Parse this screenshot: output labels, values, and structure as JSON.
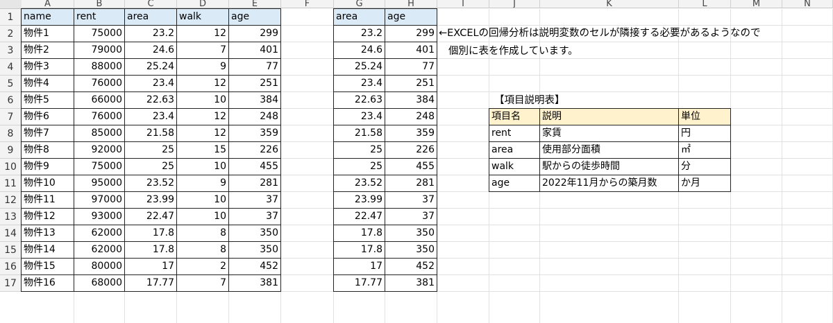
{
  "columns": [
    "A",
    "B",
    "C",
    "D",
    "E",
    "F",
    "G",
    "H",
    "I",
    "J",
    "K",
    "L",
    "M",
    "N"
  ],
  "rows": [
    "1",
    "2",
    "3",
    "4",
    "5",
    "6",
    "7",
    "8",
    "9",
    "10",
    "11",
    "12",
    "13",
    "14",
    "15",
    "16",
    "17"
  ],
  "table1": {
    "headers": [
      "name",
      "rent",
      "area",
      "walk",
      "age"
    ],
    "rows": [
      [
        "物件1",
        "75000",
        "23.2",
        "12",
        "299"
      ],
      [
        "物件2",
        "79000",
        "24.6",
        "7",
        "401"
      ],
      [
        "物件3",
        "88000",
        "25.24",
        "9",
        "77"
      ],
      [
        "物件4",
        "76000",
        "23.4",
        "12",
        "251"
      ],
      [
        "物件5",
        "66000",
        "22.63",
        "10",
        "384"
      ],
      [
        "物件6",
        "76000",
        "23.4",
        "12",
        "248"
      ],
      [
        "物件7",
        "85000",
        "21.58",
        "12",
        "359"
      ],
      [
        "物件8",
        "92000",
        "25",
        "15",
        "226"
      ],
      [
        "物件9",
        "75000",
        "25",
        "10",
        "455"
      ],
      [
        "物件10",
        "95000",
        "23.52",
        "9",
        "281"
      ],
      [
        "物件11",
        "97000",
        "23.99",
        "10",
        "37"
      ],
      [
        "物件12",
        "93000",
        "22.47",
        "10",
        "37"
      ],
      [
        "物件13",
        "62000",
        "17.8",
        "8",
        "350"
      ],
      [
        "物件14",
        "62000",
        "17.8",
        "8",
        "350"
      ],
      [
        "物件15",
        "80000",
        "17",
        "2",
        "452"
      ],
      [
        "物件16",
        "68000",
        "17.77",
        "7",
        "381"
      ]
    ]
  },
  "table2": {
    "headers": [
      "area",
      "age"
    ],
    "rows": [
      [
        "23.2",
        "299"
      ],
      [
        "24.6",
        "401"
      ],
      [
        "25.24",
        "77"
      ],
      [
        "23.4",
        "251"
      ],
      [
        "22.63",
        "384"
      ],
      [
        "23.4",
        "248"
      ],
      [
        "21.58",
        "359"
      ],
      [
        "25",
        "226"
      ],
      [
        "25",
        "455"
      ],
      [
        "23.52",
        "281"
      ],
      [
        "23.99",
        "37"
      ],
      [
        "22.47",
        "37"
      ],
      [
        "17.8",
        "350"
      ],
      [
        "17.8",
        "350"
      ],
      [
        "17",
        "452"
      ],
      [
        "17.77",
        "381"
      ]
    ]
  },
  "note": {
    "line1": "←EXCELの回帰分析は説明変数のセルが隣接する必要があるようなので",
    "line2": "個別に表を作成しています。"
  },
  "legend": {
    "title": "【項目説明表】",
    "headers": [
      "項目名",
      "説明",
      "単位"
    ],
    "rows": [
      [
        "rent",
        "家賃",
        "円"
      ],
      [
        "area",
        "使用部分面積",
        "㎡"
      ],
      [
        "walk",
        "駅からの徒歩時間",
        "分"
      ],
      [
        "age",
        "2022年11月からの築月数",
        "か月"
      ]
    ]
  },
  "colors": {
    "header_blue": "#dbeaf7",
    "header_yellow": "#fff2cc"
  }
}
